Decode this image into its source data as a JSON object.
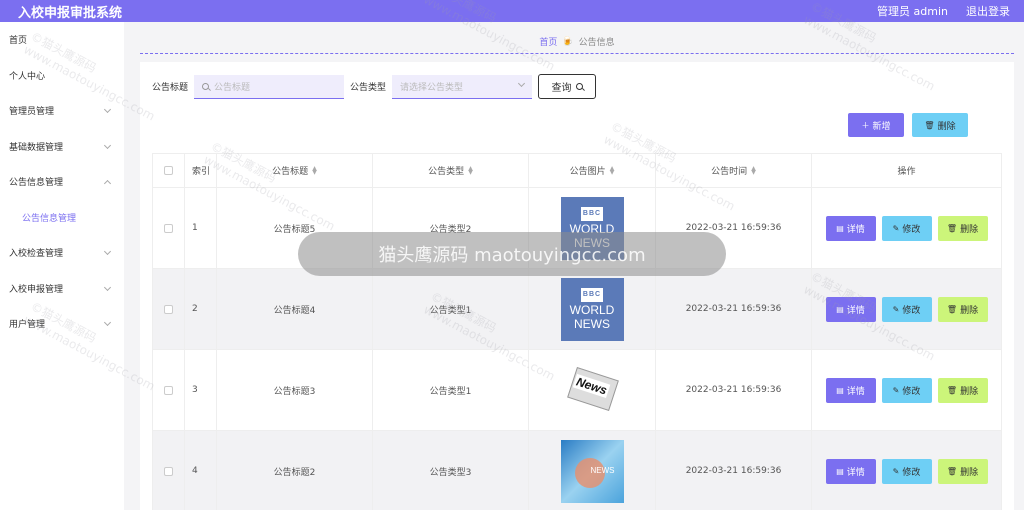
{
  "header": {
    "app_title": "入校申报审批系统",
    "user_label": "管理员 admin",
    "logout_label": "退出登录"
  },
  "sidebar": {
    "items": [
      {
        "label": "首页",
        "has_arrow": false
      },
      {
        "label": "个人中心",
        "has_arrow": false
      },
      {
        "label": "管理员管理",
        "has_arrow": true
      },
      {
        "label": "基础数据管理",
        "has_arrow": true
      },
      {
        "label": "公告信息管理",
        "has_arrow": true
      },
      {
        "label": "公告信息管理",
        "has_arrow": false,
        "sub": true
      },
      {
        "label": "入校检查管理",
        "has_arrow": true
      },
      {
        "label": "入校申报管理",
        "has_arrow": true
      },
      {
        "label": "用户管理",
        "has_arrow": true
      }
    ]
  },
  "breadcrumb": {
    "home": "首页",
    "current": "公告信息"
  },
  "search": {
    "title_label": "公告标题",
    "title_placeholder": "公告标题",
    "type_label": "公告类型",
    "type_placeholder": "请选择公告类型",
    "query_label": "查询"
  },
  "toolbar": {
    "add_label": "新增",
    "delete_label": "删除"
  },
  "table": {
    "headers": [
      "索引",
      "公告标题",
      "公告类型",
      "公告图片",
      "公告时间",
      "操作"
    ],
    "rows": [
      {
        "index": "1",
        "title": "公告标题5",
        "type": "公告类型2",
        "image": "bbc-world-news",
        "time": "2022-03-21 16:59:36"
      },
      {
        "index": "2",
        "title": "公告标题4",
        "type": "公告类型1",
        "image": "bbc-world-news",
        "time": "2022-03-21 16:59:36"
      },
      {
        "index": "3",
        "title": "公告标题3",
        "type": "公告类型1",
        "image": "news-paper",
        "time": "2022-03-21 16:59:36"
      },
      {
        "index": "4",
        "title": "公告标题2",
        "type": "公告类型3",
        "image": "world-globe-news",
        "time": "2022-03-21 16:59:36"
      }
    ],
    "actions": {
      "detail": "详情",
      "edit": "修改",
      "delete": "删除"
    }
  },
  "image_text": {
    "bbc": "BBC",
    "world": "WORLD",
    "news": "NEWS",
    "news_paper": "News"
  },
  "overlay": {
    "text": "猫头鹰源码 maotouyingcc.com"
  },
  "watermark": {
    "line1": "©猫头鹰源码",
    "line2": "www.maotouyingcc.com"
  },
  "colors": {
    "accent": "#7b6ff0",
    "info": "#6ecff5",
    "danger": "#ccf57a"
  }
}
